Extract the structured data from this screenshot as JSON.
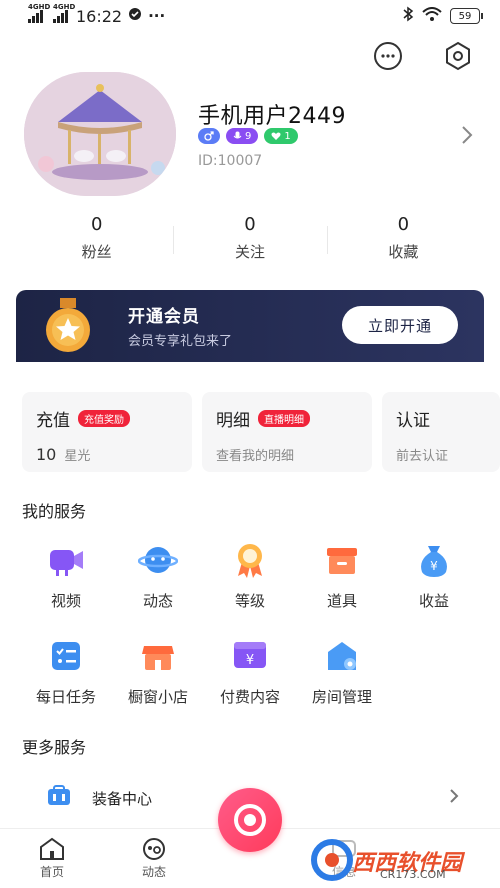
{
  "status_bar": {
    "network1": "4GHD",
    "network2": "4GHD",
    "time": "16:22",
    "dots": "···",
    "battery": "59"
  },
  "profile": {
    "username": "手机用户2449",
    "badges": {
      "level_value": "9",
      "fan_value": "1"
    },
    "user_id": "ID:10007"
  },
  "stats": [
    {
      "value": "0",
      "label": "粉丝"
    },
    {
      "value": "0",
      "label": "关注"
    },
    {
      "value": "0",
      "label": "收藏"
    }
  ],
  "vip": {
    "title": "开通会员",
    "subtitle": "会员专享礼包来了",
    "button": "立即开通"
  },
  "cards": {
    "recharge": {
      "title": "充值",
      "tag": "充值奖励",
      "value": "10",
      "unit": "星光"
    },
    "detail": {
      "title": "明细",
      "tag": "直播明细",
      "sub": "查看我的明细"
    },
    "verify": {
      "title": "认证",
      "sub": "前去认证"
    }
  },
  "my_services": {
    "title": "我的服务",
    "items": [
      {
        "label": "视频",
        "icon": "video-camera-icon"
      },
      {
        "label": "动态",
        "icon": "planet-icon"
      },
      {
        "label": "等级",
        "icon": "medal-icon"
      },
      {
        "label": "道具",
        "icon": "box-icon"
      },
      {
        "label": "收益",
        "icon": "money-bag-icon"
      },
      {
        "label": "每日任务",
        "icon": "checklist-icon"
      },
      {
        "label": "橱窗小店",
        "icon": "shop-icon"
      },
      {
        "label": "付费内容",
        "icon": "paid-content-icon"
      },
      {
        "label": "房间管理",
        "icon": "room-icon"
      }
    ]
  },
  "more_services": {
    "title": "更多服务",
    "items": [
      {
        "label": "装备中心",
        "icon": "equipment-icon"
      }
    ]
  },
  "tabbar": {
    "home": "首页",
    "feed": "动态",
    "messages": "信息"
  },
  "watermark": {
    "text": "西西软件园",
    "url": "CR173.COM"
  },
  "colors": {
    "vip_bg": "#1d2445",
    "accent_red": "#f0233a",
    "badge_blue": "#5b7cf6",
    "badge_purple": "#8a4df2",
    "badge_green": "#2fc96c",
    "icon_blue": "#3d8ef0",
    "icon_orange": "#ff7a45",
    "icon_purple": "#8656f5"
  }
}
